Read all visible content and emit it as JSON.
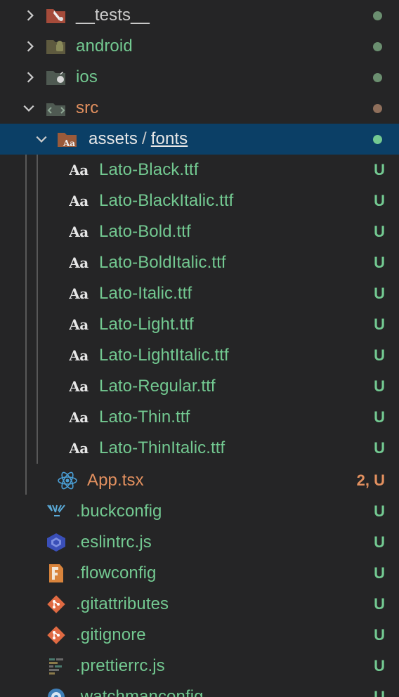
{
  "colors": {
    "untracked": "#73c991",
    "modified": "#e2905f",
    "folder_default": "#cccccc",
    "selection": "#0b3f66",
    "background": "#252526"
  },
  "rows": [
    {
      "label": "__tests__",
      "icon": "tests-folder-icon",
      "chevron": "right",
      "status_dot": "#6b8f70",
      "color": "#cccccc"
    },
    {
      "label": "android",
      "icon": "android-folder-icon",
      "chevron": "right",
      "status_dot": "#6b8f70",
      "color": "#73c991"
    },
    {
      "label": "ios",
      "icon": "ios-folder-icon",
      "chevron": "right",
      "status_dot": "#6b8f70",
      "color": "#73c991"
    },
    {
      "label": "src",
      "icon": "src-folder-icon",
      "chevron": "down",
      "status_dot": "#8f6f5b",
      "color": "#e2905f"
    },
    {
      "label_part1": "assets",
      "separator": "/",
      "label_part2": "fonts",
      "icon": "fonts-folder-icon",
      "chevron": "down",
      "status_dot": "#73c991"
    },
    {
      "label": "Lato-Black.ttf",
      "icon_text": "Aa",
      "status": "U"
    },
    {
      "label": "Lato-BlackItalic.ttf",
      "icon_text": "Aa",
      "status": "U"
    },
    {
      "label": "Lato-Bold.ttf",
      "icon_text": "Aa",
      "status": "U"
    },
    {
      "label": "Lato-BoldItalic.ttf",
      "icon_text": "Aa",
      "status": "U"
    },
    {
      "label": "Lato-Italic.ttf",
      "icon_text": "Aa",
      "status": "U"
    },
    {
      "label": "Lato-Light.ttf",
      "icon_text": "Aa",
      "status": "U"
    },
    {
      "label": "Lato-LightItalic.ttf",
      "icon_text": "Aa",
      "status": "U"
    },
    {
      "label": "Lato-Regular.ttf",
      "icon_text": "Aa",
      "status": "U"
    },
    {
      "label": "Lato-Thin.ttf",
      "icon_text": "Aa",
      "status": "U"
    },
    {
      "label": "Lato-ThinItalic.ttf",
      "icon_text": "Aa",
      "status": "U"
    },
    {
      "label": "App.tsx",
      "icon": "react-icon",
      "status": "2, U"
    },
    {
      "label": ".buckconfig",
      "icon": "buck-icon",
      "status": "U"
    },
    {
      "label": ".eslintrc.js",
      "icon": "eslint-icon",
      "status": "U"
    },
    {
      "label": ".flowconfig",
      "icon": "flow-icon",
      "status": "U"
    },
    {
      "label": ".gitattributes",
      "icon": "git-icon",
      "status": "U"
    },
    {
      "label": ".gitignore",
      "icon": "git-icon",
      "status": "U"
    },
    {
      "label": ".prettierrc.js",
      "icon": "prettier-icon",
      "status": "U"
    },
    {
      "label": ".watchmanconfig",
      "icon": "watchman-icon",
      "status": "U"
    }
  ]
}
